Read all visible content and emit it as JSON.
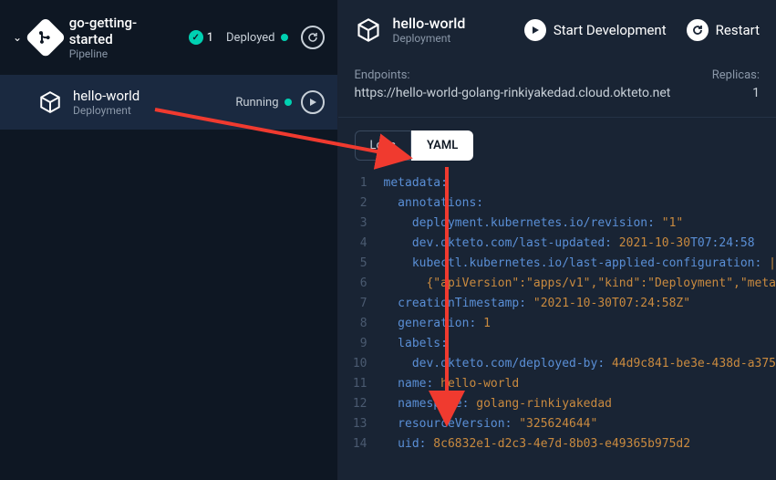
{
  "sidebar": {
    "pipeline": {
      "icon": "git-branch-icon",
      "title": "go-getting-started",
      "subtitle": "Pipeline",
      "count": "1",
      "status": "Deployed"
    },
    "deployment": {
      "icon": "cube-icon",
      "title": "hello-world",
      "subtitle": "Deployment",
      "status": "Running"
    }
  },
  "main": {
    "header": {
      "icon": "cube-icon",
      "title": "hello-world",
      "subtitle": "Deployment",
      "start_dev": "Start Development",
      "restart": "Restart"
    },
    "endpoints_label": "Endpoints:",
    "endpoints_value": "https://hello-world-golang-rinkiyakedad.cloud.okteto.net",
    "replicas_label": "Replicas:",
    "replicas_value": "1",
    "tabs": {
      "logs": "Logs",
      "yaml": "YAML"
    }
  },
  "yaml_lines": [
    {
      "n": "1",
      "ind": "",
      "k": "metadata:",
      "v": ""
    },
    {
      "n": "2",
      "ind": "  ",
      "k": "annotations:",
      "v": ""
    },
    {
      "n": "3",
      "ind": "    ",
      "k": "deployment.kubernetes.io/revision:",
      "v": " \"1\""
    },
    {
      "n": "4",
      "ind": "    ",
      "k": "dev.okteto.com/last-updated:",
      "v": " 2021-10-30",
      "t": "T07:24:58"
    },
    {
      "n": "5",
      "ind": "    ",
      "k": "kubectl.kubernetes.io/last-applied-configuration:",
      "v": " |"
    },
    {
      "n": "6",
      "ind": "      ",
      "k": "",
      "v": "{\"apiVersion\":\"apps/v1\",\"kind\":\"Deployment\",\"meta"
    },
    {
      "n": "7",
      "ind": "  ",
      "k": "creationTimestamp:",
      "v": " \"2021-10-30T07:24:58Z\""
    },
    {
      "n": "8",
      "ind": "  ",
      "k": "generation:",
      "v": " 1"
    },
    {
      "n": "9",
      "ind": "  ",
      "k": "labels:",
      "v": ""
    },
    {
      "n": "10",
      "ind": "    ",
      "k": "dev.okteto.com/deployed-by:",
      "v": " 44d9c841-be3e-438d-a375"
    },
    {
      "n": "11",
      "ind": "  ",
      "k": "name:",
      "v": " hello-world"
    },
    {
      "n": "12",
      "ind": "  ",
      "k": "namespace:",
      "v": " golang-rinkiyakedad"
    },
    {
      "n": "13",
      "ind": "  ",
      "k": "resourceVersion:",
      "v": " \"325624644\""
    },
    {
      "n": "14",
      "ind": "  ",
      "k": "uid:",
      "v": " 8c6832e1-d2c3-4e7d-8b03-e49365b975d2"
    }
  ],
  "colors": {
    "accent": "#00d1b2",
    "arrow": "#f03a2f"
  }
}
